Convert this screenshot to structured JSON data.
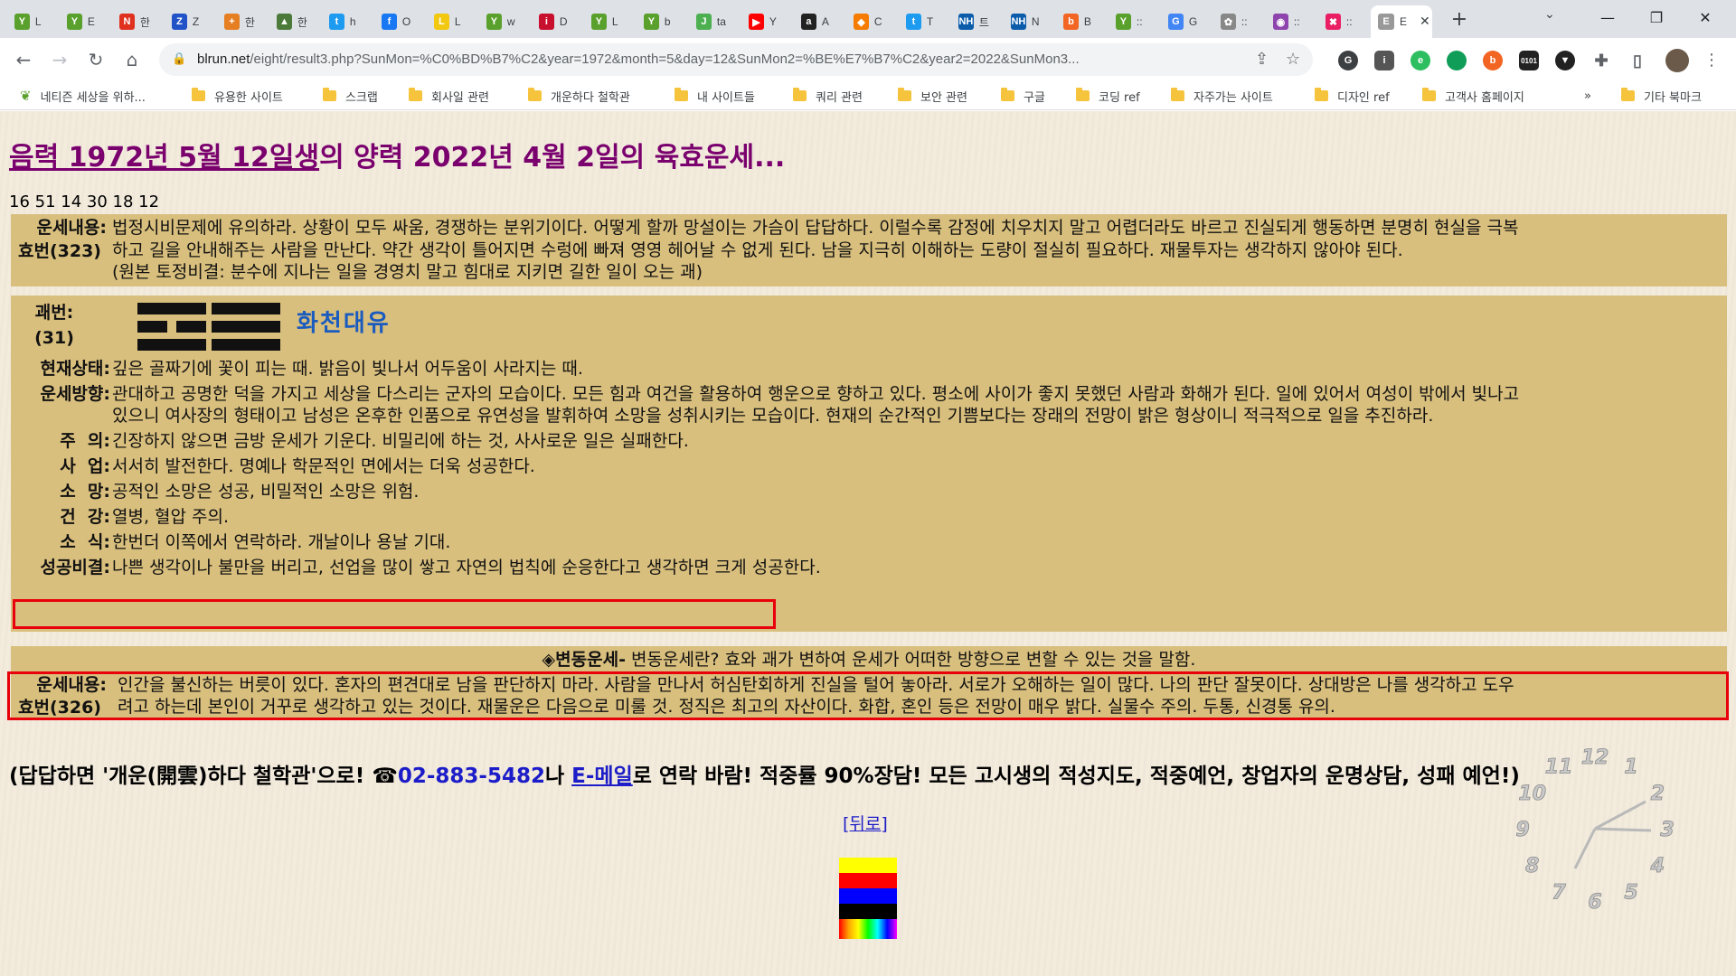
{
  "browser": {
    "tabs": [
      {
        "fav_color": "#5aa02c",
        "fav_glyph": "Y",
        "title": "L"
      },
      {
        "fav_color": "#5aa02c",
        "fav_glyph": "Y",
        "title": "E"
      },
      {
        "fav_color": "#e0301e",
        "fav_glyph": "N",
        "title": "한"
      },
      {
        "fav_color": "#2152c8",
        "fav_glyph": "Z",
        "title": "Z"
      },
      {
        "fav_color": "#e67e22",
        "fav_glyph": "+",
        "title": "한"
      },
      {
        "fav_color": "#4c7a3a",
        "fav_glyph": "▲",
        "title": "한"
      },
      {
        "fav_color": "#1d9bf0",
        "fav_glyph": "t",
        "title": "h"
      },
      {
        "fav_color": "#1877f2",
        "fav_glyph": "f",
        "title": "O"
      },
      {
        "fav_color": "#f2c811",
        "fav_glyph": "L",
        "title": "L"
      },
      {
        "fav_color": "#5aa02c",
        "fav_glyph": "Y",
        "title": "w"
      },
      {
        "fav_color": "#c8102e",
        "fav_glyph": "i",
        "title": "D"
      },
      {
        "fav_color": "#5aa02c",
        "fav_glyph": "Y",
        "title": "L"
      },
      {
        "fav_color": "#5aa02c",
        "fav_glyph": "Y",
        "title": "b"
      },
      {
        "fav_color": "#4caf50",
        "fav_glyph": "J",
        "title": "ta"
      },
      {
        "fav_color": "#ff0000",
        "fav_glyph": "▶",
        "title": "Y"
      },
      {
        "fav_color": "#222222",
        "fav_glyph": "a",
        "title": "A"
      },
      {
        "fav_color": "#f57c00",
        "fav_glyph": "◆",
        "title": "C"
      },
      {
        "fav_color": "#1d9bf0",
        "fav_glyph": "t",
        "title": "T"
      },
      {
        "fav_color": "#0b5cab",
        "fav_glyph": "NH",
        "title": "트"
      },
      {
        "fav_color": "#0b5cab",
        "fav_glyph": "NH",
        "title": "N"
      },
      {
        "fav_color": "#f26522",
        "fav_glyph": "b",
        "title": "B"
      },
      {
        "fav_color": "#5aa02c",
        "fav_glyph": "Y",
        "title": "::"
      },
      {
        "fav_color": "#4285f4",
        "fav_glyph": "G",
        "title": "G"
      },
      {
        "fav_color": "#888888",
        "fav_glyph": "✿",
        "title": "::"
      },
      {
        "fav_color": "#8e44ad",
        "fav_glyph": "◉",
        "title": "::"
      },
      {
        "fav_color": "#e91e63",
        "fav_glyph": "✖",
        "title": "::"
      },
      {
        "fav_color": "#999999",
        "fav_glyph": "E",
        "title": "E",
        "active": true
      }
    ],
    "url_host": "blrun.net",
    "url_path": "/eight/result3.php?SunMon=%C0%BD%B7%C2&year=1972&month=5&day=12&SunMon2=%BE%E7%B7%C2&year2=2022&SunMon3...",
    "bookmarks": [
      {
        "label": "네티즌 세상을 위하...",
        "icon": "sprout"
      },
      {
        "label": "유용한 사이트",
        "icon": "folder"
      },
      {
        "label": "스크랩",
        "icon": "folder"
      },
      {
        "label": "회사일 관련",
        "icon": "folder"
      },
      {
        "label": "개운하다 철학관",
        "icon": "folder"
      },
      {
        "label": "내 사이트들",
        "icon": "folder"
      },
      {
        "label": "쿼리 관련",
        "icon": "folder"
      },
      {
        "label": "보안 관련",
        "icon": "folder"
      },
      {
        "label": "구글",
        "icon": "folder"
      },
      {
        "label": "코딩 ref",
        "icon": "folder"
      },
      {
        "label": "자주가는 사이트",
        "icon": "folder"
      },
      {
        "label": "디자인 ref",
        "icon": "folder"
      },
      {
        "label": "고객사 홈페이지",
        "icon": "folder"
      },
      {
        "label": "기타 북마크",
        "icon": "folder"
      }
    ],
    "more_bookmarks": "»"
  },
  "page": {
    "title_link": "음력 1972년 5월 12일생",
    "title_rest": "의 양력 2022년 4월 2일의 육효운세...",
    "numbers": "16 51 14 30 18 12",
    "section1": {
      "label_a": "운세내용:",
      "label_b": "효번(323)",
      "line1": "법정시비문제에 유의하라. 상황이 모두 싸움, 경쟁하는 분위기이다. 어떻게 할까 망설이는 가슴이 답답하다. 이럴수록 감정에 치우치지 말고 어렵더라도 바르고 진실되게 행동하면 분명히 현실을 극복",
      "line2": "하고 길을 안내해주는 사람을 만난다. 약간 생각이 틀어지면 수렁에 빠져 영영 헤어날 수 없게 된다. 남을 지극히 이해하는 도량이 절실히 필요하다. 재물투자는 생각하지 않아야 된다.",
      "line3": "(원본 토정비결: 분수에 지나는 일을 경영치 말고 힘대로 지키면 길한 일이 오는 괘)"
    },
    "section2": {
      "gwae_label": "괘번:",
      "gwae_num": "(31)",
      "hex_name": "화천대유",
      "rows": [
        {
          "label": "현재상태:",
          "text": "깊은 골짜기에 꽃이 피는 때. 밝음이 빛나서 어두움이 사라지는 때."
        },
        {
          "label": "운세방향:",
          "text": "관대하고 공명한 덕을 가지고 세상을 다스리는 군자의 모습이다. 모든 힘과 여건을 활용하여 행운으로 향하고 있다. 평소에 사이가 좋지 못했던 사람과 화해가 된다. 일에 있어서 여성이 밖에서 빛나고",
          "text2": "있으니 여사장의 형태이고 남성은 온후한 인품으로 유연성을 발휘하여 소망을 성취시키는 모습이다. 현재의 순간적인 기쁨보다는 장래의 전망이 밝은 형상이니 적극적으로 일을 추진하라."
        },
        {
          "label": "주  의:",
          "text": "긴장하지 않으면 금방 운세가 기운다. 비밀리에 하는 것, 사사로운 일은 실패한다."
        },
        {
          "label": "사  업:",
          "text": "서서히 발전한다. 명예나 학문적인 면에서는 더욱 성공한다."
        },
        {
          "label": "소  망:",
          "text": "공적인 소망은 성공, 비밀적인 소망은 위험."
        },
        {
          "label": "건  강:",
          "text": "열병, 혈압 주의."
        },
        {
          "label": "소  식:",
          "text": "한번더 이쪽에서 연락하라. 개날이나 용날 기대."
        },
        {
          "label": "성공비결:",
          "text": "나쁜 생각이나 불만을 버리고, 선업을 많이 쌓고 자연의 법칙에 순응한다고 생각하면 크게 성공한다."
        }
      ]
    },
    "clock_numbers": [
      "12",
      "1",
      "2",
      "3",
      "4",
      "5",
      "6",
      "7",
      "8",
      "9",
      "10",
      "11"
    ],
    "section3": {
      "header_bold": "◈변동운세-",
      "header_text": " 변동운세란? 효와 괘가 변하여 운세가 어떠한 방향으로 변할 수 있는 것을 말함.",
      "label_a": "운세내용:",
      "label_b": "효번(326)",
      "line1": "인간을 불신하는 버릇이 있다. 혼자의 편견대로 남을 판단하지 마라. 사람을 만나서 허심탄회하게 진실을 털어 놓아라. 서로가 오해하는 일이 많다. 나의 판단 잘못이다. 상대방은 나를 생각하고 도우",
      "line2": "려고 하는데 본인이 거꾸로 생각하고 있는 것이다. 재물운은 다음으로 미룰 것. 정직은 최고의 자산이다. 화합, 혼인 등은 전망이 매우 밝다. 실물수 주의. 두통, 신경통 유의."
    },
    "contact": {
      "part1": "(답답하면 '개운(開雲)하다 철학관'으로! ☎",
      "phone": "02-883-5482",
      "part2": "나 ",
      "email": "E-메일",
      "part3": "로 연락 바람! 적중률 90%장담! 모든 고시생의 적성지도, 적중예언, 창업자의 운명상담, 성패 예언!)"
    },
    "back_link": "[뒤로]",
    "stripe_colors": [
      "#ffff00",
      "#ff0000",
      "#0000ff",
      "#000000"
    ]
  }
}
